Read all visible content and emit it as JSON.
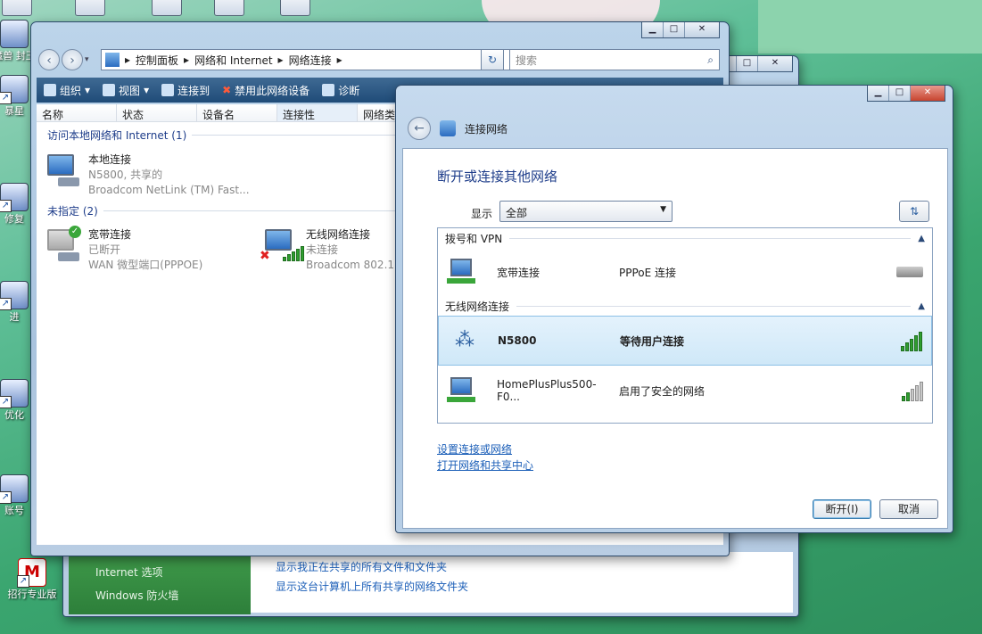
{
  "desktop": {
    "icons": [
      {
        "label": "魔兽\n封王"
      },
      {
        "label": "暴星"
      },
      {
        "label": "修复"
      },
      {
        "label": "进"
      },
      {
        "label": "优化"
      },
      {
        "label": "账号"
      },
      {
        "label": "招行专业版"
      }
    ]
  },
  "explorer": {
    "breadcrumb": [
      "控制面板",
      "网络和 Internet",
      "网络连接"
    ],
    "search_placeholder": "搜索",
    "toolbar": [
      "组织",
      "视图",
      "连接到",
      "禁用此网络设备",
      "诊断"
    ],
    "columns": [
      "名称",
      "状态",
      "设备名",
      "连接性",
      "网络类"
    ],
    "groups": [
      {
        "title": "访问本地网络和 Internet (1)"
      },
      {
        "title": "未指定 (2)"
      }
    ],
    "connections": [
      {
        "name": "本地连接",
        "line2": "N5800, 共享的",
        "line3": "Broadcom NetLink (TM) Fast..."
      },
      {
        "name": "宽带连接",
        "line2": "已断开",
        "line3": "WAN 微型端口(PPPOE)"
      },
      {
        "name": "无线网络连接",
        "line2": "未连接",
        "line3": "Broadcom 802.1"
      }
    ]
  },
  "back_window": {
    "links": [
      "Internet 选项",
      "Windows 防火墙"
    ],
    "tasks": [
      "显示我正在共享的所有文件和文件夹",
      "显示这台计算机上所有共享的网络文件夹"
    ]
  },
  "dialog": {
    "title": "连接网络",
    "heading": "断开或连接其他网络",
    "show_label": "显示",
    "show_value": "全部",
    "sections": [
      {
        "title": "拨号和 VPN"
      },
      {
        "title": "无线网络连接"
      }
    ],
    "networks": [
      {
        "name": "宽带连接",
        "status": "PPPoE 连接"
      },
      {
        "name": "N5800",
        "status": "等待用户连接"
      },
      {
        "name": "HomePlusPlus500-F0...",
        "status": "启用了安全的网络"
      }
    ],
    "links": [
      "设置连接或网络",
      "打开网络和共享中心"
    ],
    "buttons": {
      "disconnect": "断开(I)",
      "cancel": "取消"
    }
  }
}
